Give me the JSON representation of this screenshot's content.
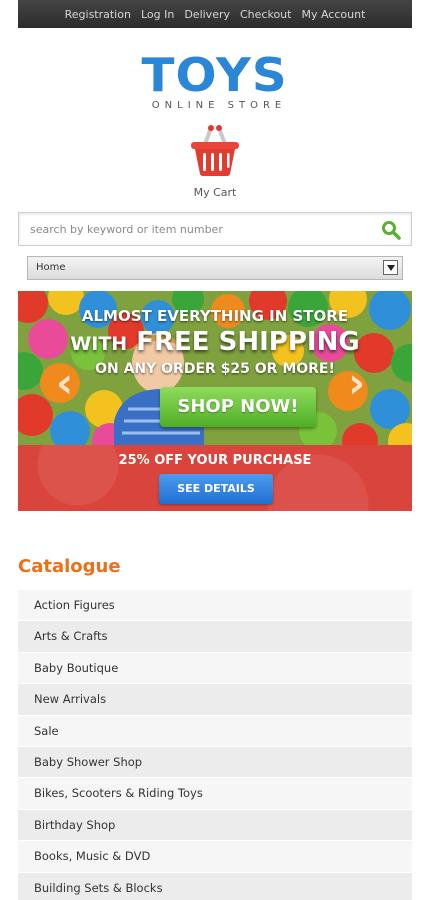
{
  "topnav": {
    "links": [
      "Registration",
      "Log In",
      "Delivery",
      "Checkout",
      "My Account"
    ]
  },
  "logo": {
    "main": "TOYS",
    "sub": "ONLINE STORE"
  },
  "cart": {
    "label": "My Cart",
    "icon": "basket-icon"
  },
  "search": {
    "placeholder": "search by keyword or item number",
    "value": "",
    "icon": "search-icon"
  },
  "nav_select": {
    "selected": "Home"
  },
  "banner": {
    "line1": "ALMOST EVERYTHING IN STORE",
    "line2_prefix": "WITH",
    "line2_main": "FREE SHIPPING",
    "line3": "ON ANY ORDER $25 OR MORE!",
    "shop_button": "SHOP NOW!",
    "offer_text": "25% OFF YOUR PURCHASE",
    "details_button": "SEE DETAILS"
  },
  "catalogue": {
    "title": "Catalogue",
    "items": [
      "Action Figures",
      "Arts & Crafts",
      "Baby Boutique",
      "New Arrivals",
      "Sale",
      "Baby Shower Shop",
      "Bikes, Scooters & Riding Toys",
      "Birthday Shop",
      "Books, Music & DVD",
      "Building Sets & Blocks"
    ]
  },
  "colors": {
    "logo_blue": "#2a86d6",
    "catalogue_orange": "#ec6f1a",
    "shop_green": "#5cbf2e",
    "promo_red": "#d9443d",
    "details_blue": "#2f83e0"
  }
}
